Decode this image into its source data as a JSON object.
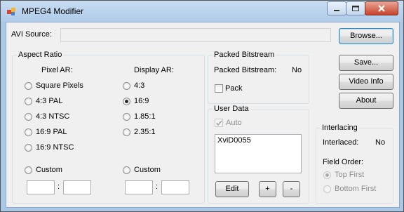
{
  "window": {
    "title": "MPEG4 Modifier"
  },
  "avi_source": {
    "label": "AVI Source:",
    "value": ""
  },
  "buttons": {
    "browse": "Browse...",
    "save": "Save...",
    "video_info": "Video Info",
    "about": "About"
  },
  "aspect_ratio": {
    "title": "Aspect Ratio",
    "pixel_header": "Pixel AR:",
    "display_header": "Display AR:",
    "pixel_options": [
      "Square Pixels",
      "4:3 PAL",
      "4:3 NTSC",
      "16:9 PAL",
      "16:9 NTSC"
    ],
    "display_options": [
      "4:3",
      "16:9",
      "1.85:1",
      "2.35:1"
    ],
    "display_selected": "16:9",
    "custom_label": "Custom",
    "separator": ":"
  },
  "packed": {
    "title": "Packed Bitstream",
    "label": "Packed Bitstream:",
    "value": "No",
    "checkbox": "Pack"
  },
  "user_data": {
    "title": "User Data",
    "auto": "Auto",
    "text": "XviD0055",
    "edit": "Edit",
    "add": "+",
    "remove": "-"
  },
  "interlacing": {
    "title": "Interlacing",
    "label": "Interlaced:",
    "value": "No",
    "field_order": "Field Order:",
    "top_first": "Top First",
    "bottom_first": "Bottom First"
  }
}
